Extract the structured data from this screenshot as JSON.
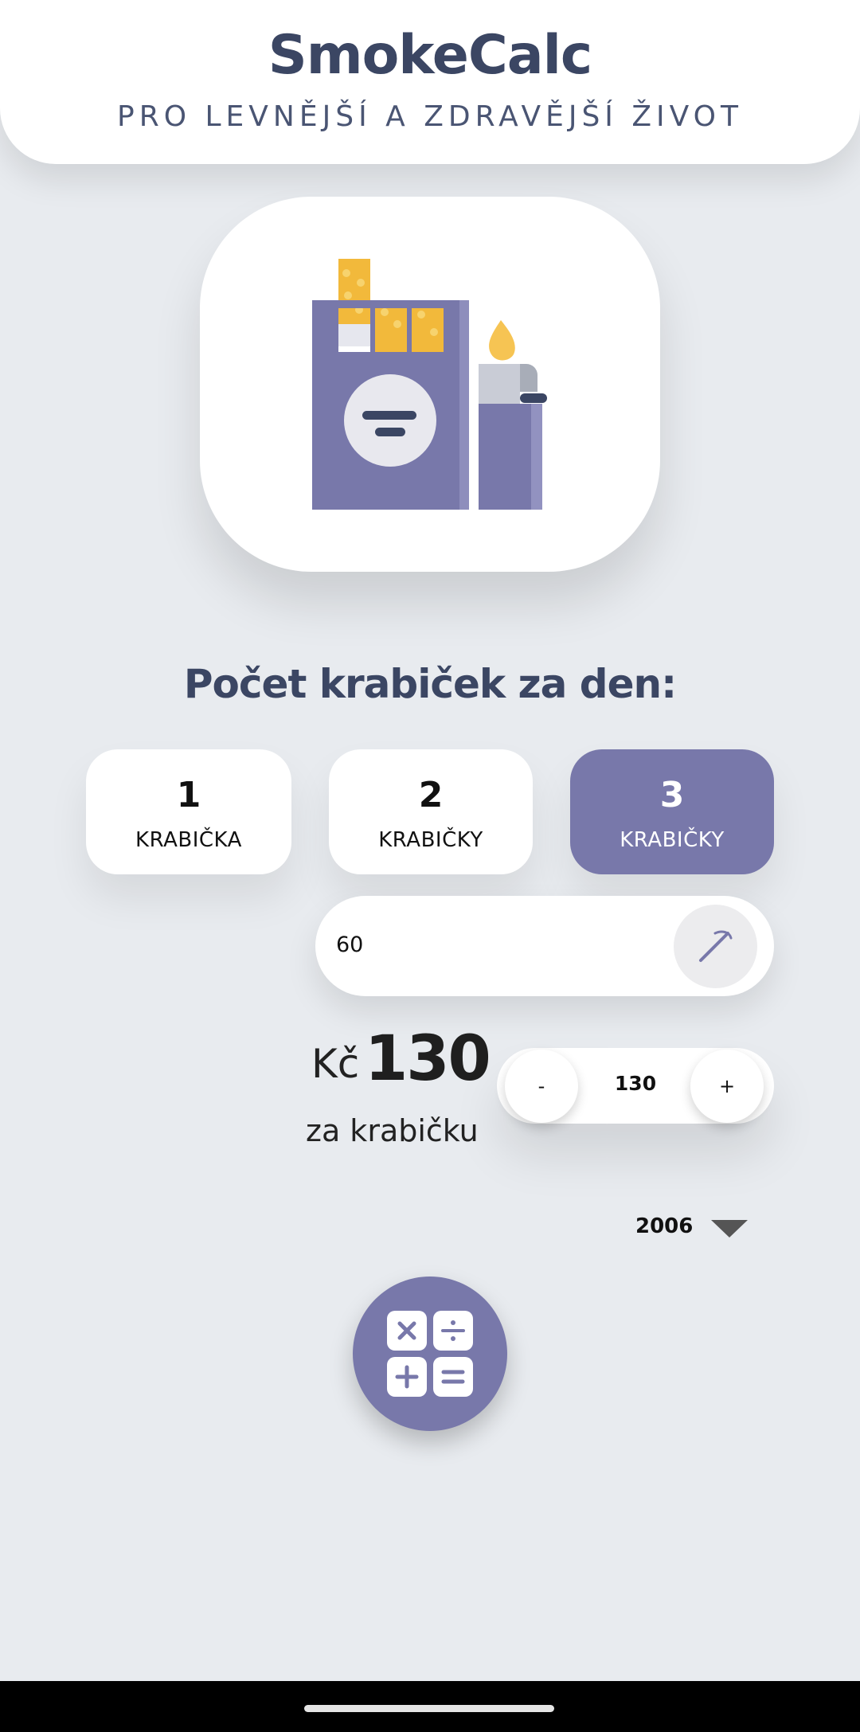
{
  "header": {
    "title": "SmokeCalc",
    "subtitle": "PRO LEVNĚJŠÍ A ZDRAVĚJŠÍ ŽIVOT"
  },
  "hero": {
    "icon": "cigarette-pack-lighter-icon"
  },
  "section": {
    "title": "Počet krabiček za den:"
  },
  "pack_options": [
    {
      "number": "1",
      "label": "KRABIČKA",
      "selected": false
    },
    {
      "number": "2",
      "label": "KRABIČKY",
      "selected": false
    },
    {
      "number": "3",
      "label": "KRABIČKY",
      "selected": true
    }
  ],
  "count_field": {
    "value": "60",
    "edit_icon": "cigarette-edit-icon"
  },
  "price": {
    "currency": "Kč",
    "value": "130",
    "unit": "za krabičku"
  },
  "stepper": {
    "minus": "-",
    "value": "130",
    "plus": "+"
  },
  "year": {
    "selected": "2006",
    "icon": "dropdown-arrow-icon"
  },
  "calculate_button": {
    "icon": "calculator-icon"
  },
  "colors": {
    "accent": "#7878aa",
    "background": "#e8ebef",
    "title": "#3b4663",
    "cigarette": "#f2b93b"
  }
}
